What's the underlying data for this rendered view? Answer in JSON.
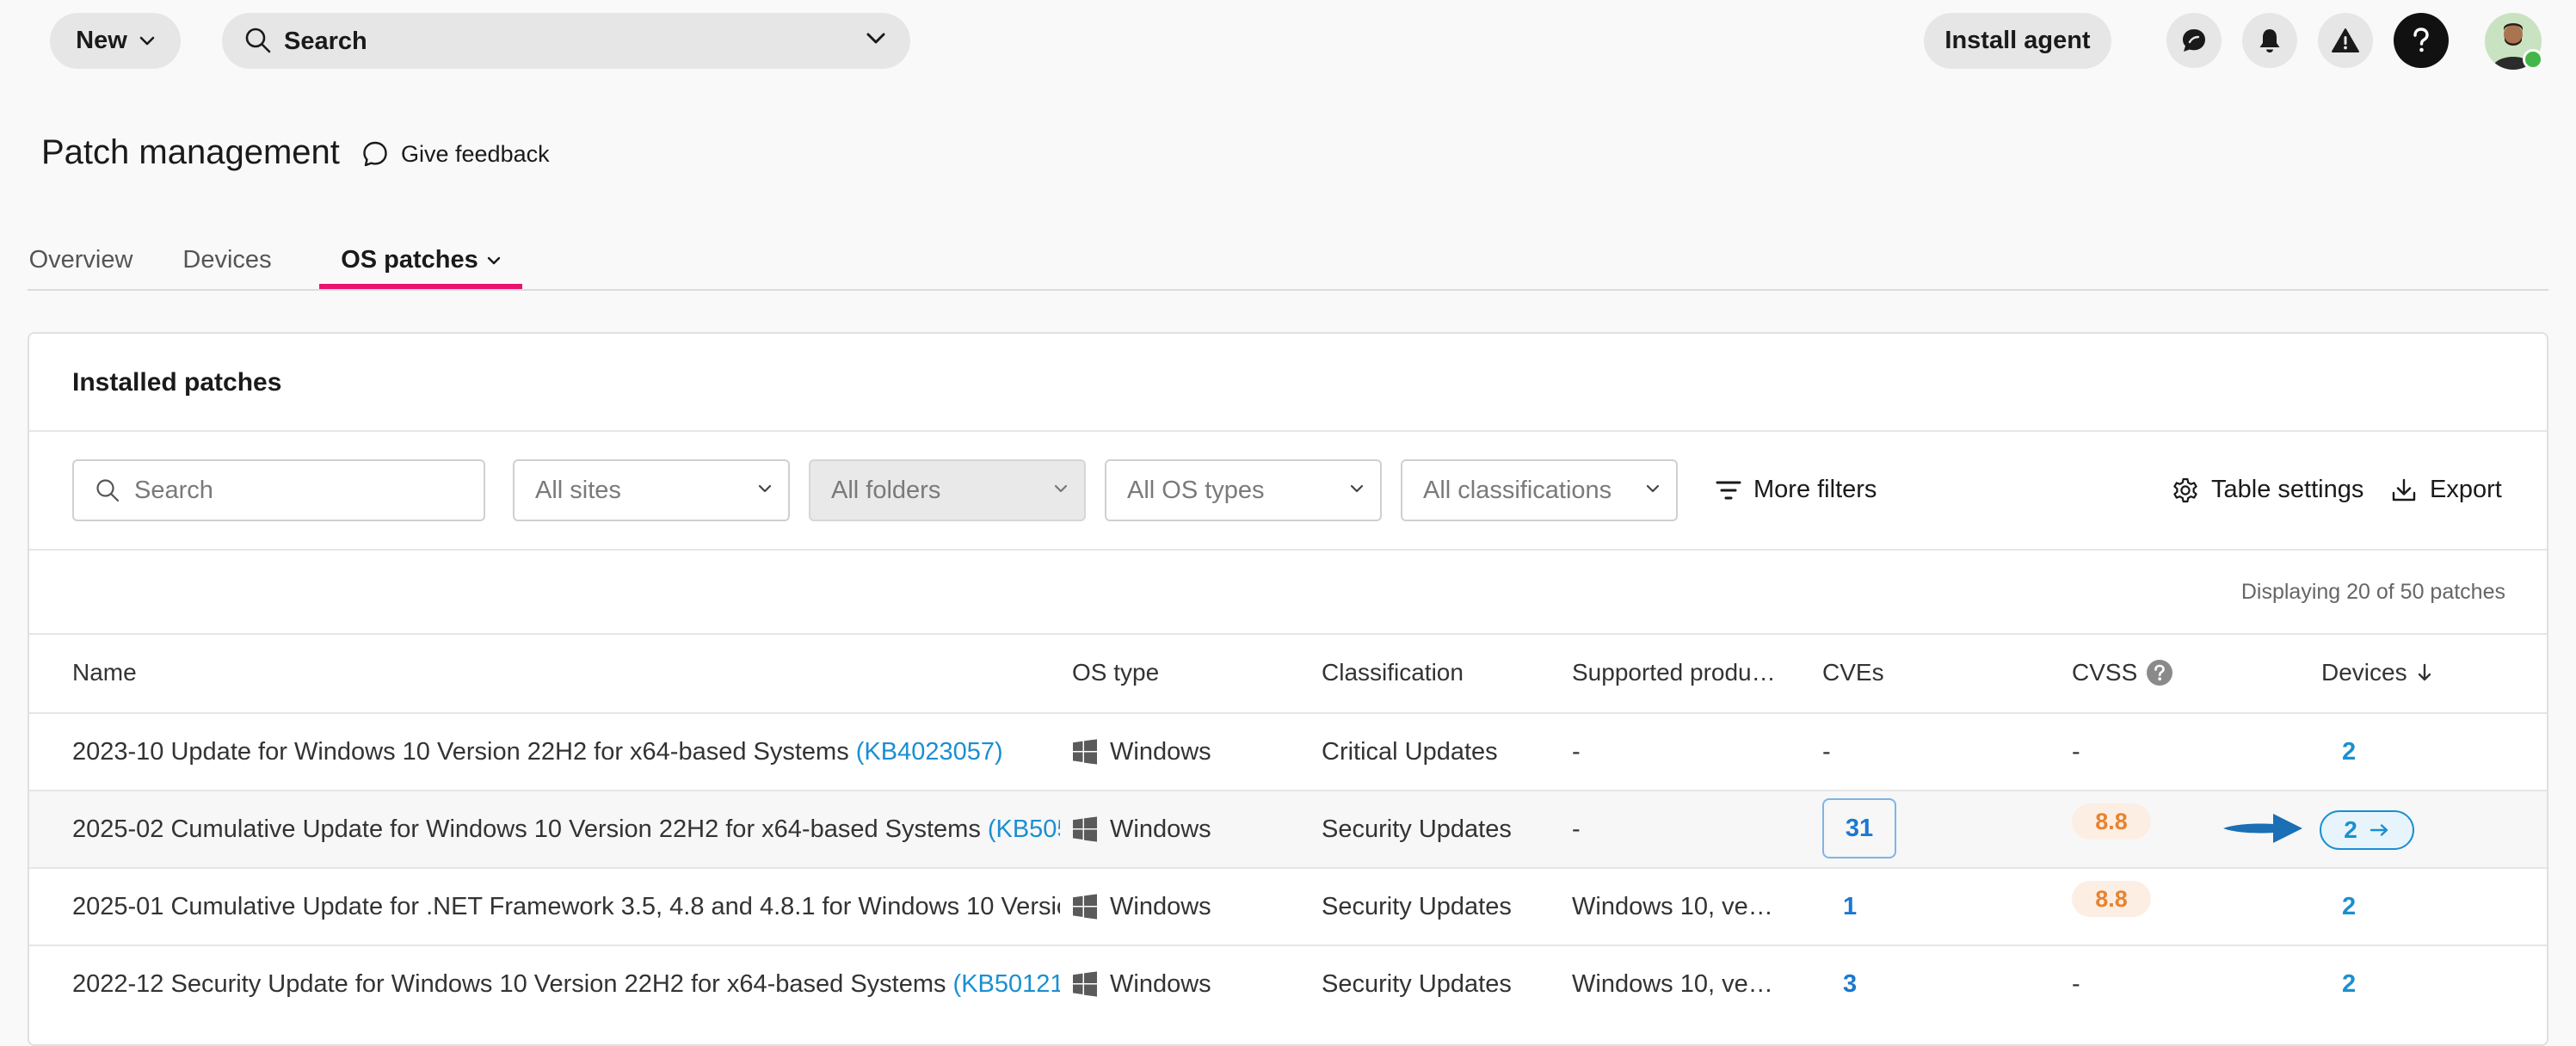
{
  "topbar": {
    "new_label": "New",
    "search_label": "Search",
    "install_label": "Install agent"
  },
  "header": {
    "title": "Patch management",
    "feedback_label": "Give feedback"
  },
  "tabs": [
    {
      "label": "Overview"
    },
    {
      "label": "Devices"
    },
    {
      "label": "OS patches",
      "active": true
    }
  ],
  "card": {
    "title": "Installed patches",
    "search_placeholder": "Search",
    "filters": [
      "All sites",
      "All folders",
      "All OS types",
      "All classifications"
    ],
    "more_filters": "More filters",
    "table_settings": "Table settings",
    "export": "Export",
    "display_count": "Displaying 20 of 50 patches"
  },
  "table": {
    "columns": [
      "Name",
      "OS type",
      "Classification",
      "Supported produ…",
      "CVEs",
      "CVSS",
      "Devices"
    ],
    "rows": [
      {
        "name": "2023-10 Update for Windows 10 Version 22H2 for x64-based Systems",
        "kb": "(KB4023057)",
        "os": "Windows",
        "classification": "Critical Updates",
        "supported": "-",
        "cves": "-",
        "cvss": "-",
        "devices": "2"
      },
      {
        "name": "2025-02 Cumulative Update for Windows 10 Version 22H2 for x64-based Systems",
        "kb": "(KB505",
        "os": "Windows",
        "classification": "Security Updates",
        "supported": "-",
        "cves": "31",
        "cvss": "8.8",
        "devices": "2"
      },
      {
        "name": "2025-01 Cumulative Update for .NET Framework 3.5, 4.8 and 4.8.1 for Windows 10 Versior",
        "kb": "",
        "os": "Windows",
        "classification": "Security Updates",
        "supported": "Windows 10, vers…",
        "cves": "1",
        "cvss": "8.8",
        "devices": "2"
      },
      {
        "name": "2022-12 Security Update for Windows 10 Version 22H2 for x64-based Systems",
        "kb": "(KB501217",
        "os": "Windows",
        "classification": "Security Updates",
        "supported": "Windows 10, vers…",
        "cves": "3",
        "cvss": "-",
        "devices": "2"
      }
    ]
  },
  "colors": {
    "accent": "#e8146e",
    "link": "#1b8fd0",
    "cvss_high_text": "#e8832e",
    "cvss_high_bg": "#fdeee4",
    "pointer_arrow": "#1a6fb5"
  },
  "icons": {
    "search": "search-icon",
    "chevron": "chevron-down-icon",
    "chat": "chat-icon",
    "bell": "bell-icon",
    "alert": "alert-icon",
    "help": "help-icon",
    "feedback": "feedback-bubble-icon",
    "filter": "filter-icon",
    "gear": "gear-icon",
    "download": "download-icon",
    "windows": "windows-logo-icon",
    "sort": "arrow-down-icon"
  }
}
